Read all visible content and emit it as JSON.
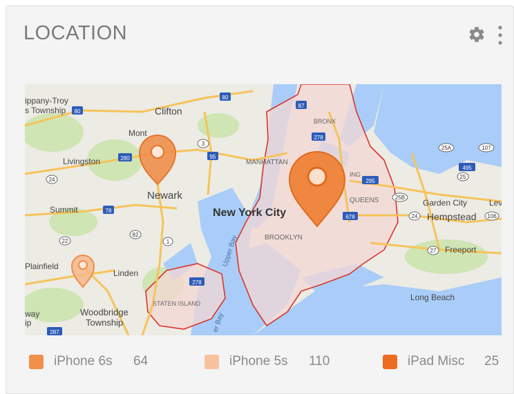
{
  "card": {
    "title": "LOCATION"
  },
  "header_icons": [
    "gear-icon",
    "more-vert-icon"
  ],
  "map": {
    "labels": {
      "parsippany": "ippany-Troy",
      "township": "s Township",
      "clifton": "Clifton",
      "mont": "Mont",
      "livingston": "Livingston",
      "newark": "Newark",
      "manhattan": "MANHATTAN",
      "bronx": "BRONX",
      "queens": "QUEENS",
      "nyc": "New York City",
      "brooklyn": "BROOKLYN",
      "summit": "Summit",
      "garden_city": "Garden City",
      "hempstead": "Hempstead",
      "lev": "Lev",
      "freeport": "Freeport",
      "plainfield": "Plainfield",
      "linden": "Linden",
      "staten_island": "STATEN ISLAND",
      "long_beach": "Long Beach",
      "woodbridge": "Woodbridge",
      "woodbridge2": "Township",
      "way": "way",
      "ip": "ip",
      "upper_bay": "Upper Bay",
      "lower_bay": "er Bay",
      "ing": "ING"
    },
    "shields": [
      "80",
      "87",
      "278",
      "280",
      "95",
      "3",
      "24",
      "78",
      "82",
      "22",
      "1",
      "295",
      "495",
      "25A",
      "107",
      "25",
      "25B",
      "678",
      "24",
      "106",
      "27",
      "278",
      "287",
      "80"
    ]
  },
  "legend": [
    {
      "label": "iPhone 6s",
      "count": "64",
      "color": "#f0904a"
    },
    {
      "label": "iPhone 5s",
      "count": "110",
      "color": "#f6c29e"
    },
    {
      "label": "iPad Misc",
      "count": "25",
      "color": "#ee6c22"
    }
  ],
  "colors": {
    "pin_medium": "#f08a44",
    "pin_light": "#f5b98a",
    "pin_large": "#ee7d30",
    "water": "#a9cdf8",
    "nyc_fill": "#f4d7d4",
    "nyc_border": "#d9342b",
    "highway": "#f6c35a"
  }
}
